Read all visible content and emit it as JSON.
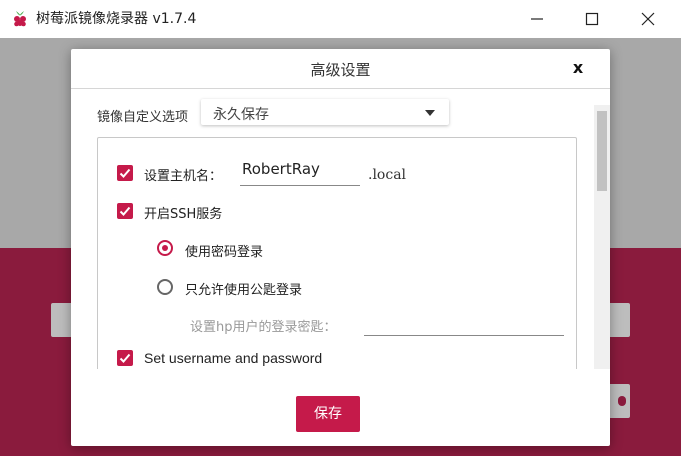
{
  "window": {
    "title": "树莓派镜像烧录器 v1.7.4",
    "icons": {
      "logo": "raspberry-pi-logo",
      "minimize": "minimize-icon",
      "maximize": "maximize-icon",
      "close": "close-icon"
    }
  },
  "dialog": {
    "title": "高级设置",
    "close_label": "x",
    "image_options": {
      "label": "镜像自定义选项",
      "selected": "永久保存"
    },
    "hostname": {
      "checked": true,
      "label": "设置主机名：",
      "value": "RobertRay",
      "suffix": ".local"
    },
    "ssh": {
      "checked": true,
      "label": "开启SSH服务",
      "password_auth": {
        "label": "使用密码登录",
        "selected": true
      },
      "pubkey_auth": {
        "label": "只允许使用公匙登录",
        "selected": false
      },
      "key_label": "设置hp用户的登录密匙：",
      "key_value": ""
    },
    "user": {
      "checked": true,
      "label": "Set username and password"
    },
    "save_label": "保存"
  },
  "colors": {
    "accent": "#c51a4a",
    "overlay_bg": "#a8a8a8",
    "overlay_red": "#8a1b3d"
  }
}
